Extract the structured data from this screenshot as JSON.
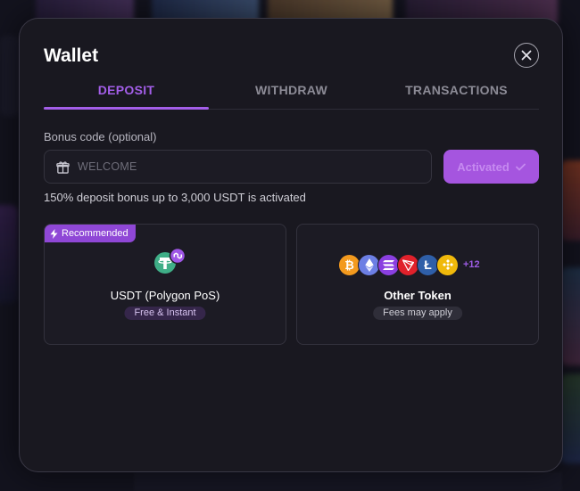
{
  "wallet": {
    "title": "Wallet",
    "tabs": [
      {
        "label": "DEPOSIT",
        "active": true
      },
      {
        "label": "WITHDRAW",
        "active": false
      },
      {
        "label": "TRANSACTIONS",
        "active": false
      }
    ],
    "bonus": {
      "label": "Bonus code (optional)",
      "value": "WELCOME",
      "button_label": "Activated",
      "info": "150% deposit bonus up to 3,000 USDT is activated"
    },
    "options": [
      {
        "badge": "Recommended",
        "name": "USDT (Polygon PoS)",
        "tag": "Free & Instant",
        "icon": "usdt-polygon-icon"
      },
      {
        "name": "Other Token",
        "tag": "Fees may apply",
        "coins": [
          "bitcoin-icon",
          "ethereum-icon",
          "solana-icon",
          "tron-icon",
          "litecoin-icon",
          "bnb-icon"
        ],
        "more": "+12"
      }
    ]
  },
  "colors": {
    "accent": "#a35ee8",
    "modal_bg": "#191820",
    "button_bg": "#a555df"
  }
}
